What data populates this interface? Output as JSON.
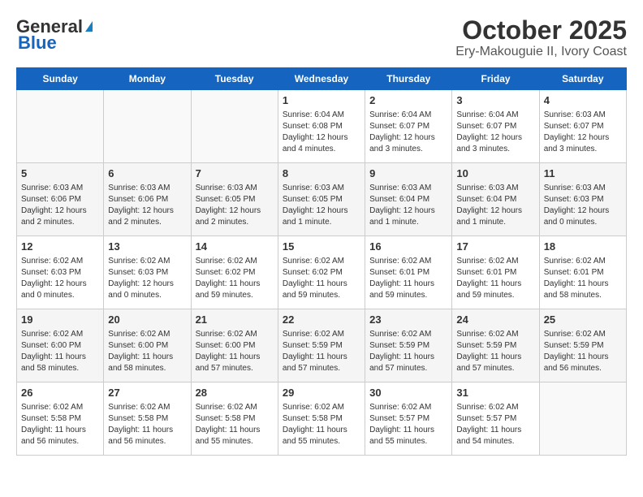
{
  "header": {
    "logo_line1": "General",
    "logo_line2": "Blue",
    "title": "October 2025",
    "subtitle": "Ery-Makouguie II, Ivory Coast"
  },
  "days_of_week": [
    "Sunday",
    "Monday",
    "Tuesday",
    "Wednesday",
    "Thursday",
    "Friday",
    "Saturday"
  ],
  "weeks": [
    [
      {
        "day": "",
        "content": ""
      },
      {
        "day": "",
        "content": ""
      },
      {
        "day": "",
        "content": ""
      },
      {
        "day": "1",
        "content": "Sunrise: 6:04 AM\nSunset: 6:08 PM\nDaylight: 12 hours\nand 4 minutes."
      },
      {
        "day": "2",
        "content": "Sunrise: 6:04 AM\nSunset: 6:07 PM\nDaylight: 12 hours\nand 3 minutes."
      },
      {
        "day": "3",
        "content": "Sunrise: 6:04 AM\nSunset: 6:07 PM\nDaylight: 12 hours\nand 3 minutes."
      },
      {
        "day": "4",
        "content": "Sunrise: 6:03 AM\nSunset: 6:07 PM\nDaylight: 12 hours\nand 3 minutes."
      }
    ],
    [
      {
        "day": "5",
        "content": "Sunrise: 6:03 AM\nSunset: 6:06 PM\nDaylight: 12 hours\nand 2 minutes."
      },
      {
        "day": "6",
        "content": "Sunrise: 6:03 AM\nSunset: 6:06 PM\nDaylight: 12 hours\nand 2 minutes."
      },
      {
        "day": "7",
        "content": "Sunrise: 6:03 AM\nSunset: 6:05 PM\nDaylight: 12 hours\nand 2 minutes."
      },
      {
        "day": "8",
        "content": "Sunrise: 6:03 AM\nSunset: 6:05 PM\nDaylight: 12 hours\nand 1 minute."
      },
      {
        "day": "9",
        "content": "Sunrise: 6:03 AM\nSunset: 6:04 PM\nDaylight: 12 hours\nand 1 minute."
      },
      {
        "day": "10",
        "content": "Sunrise: 6:03 AM\nSunset: 6:04 PM\nDaylight: 12 hours\nand 1 minute."
      },
      {
        "day": "11",
        "content": "Sunrise: 6:03 AM\nSunset: 6:03 PM\nDaylight: 12 hours\nand 0 minutes."
      }
    ],
    [
      {
        "day": "12",
        "content": "Sunrise: 6:02 AM\nSunset: 6:03 PM\nDaylight: 12 hours\nand 0 minutes."
      },
      {
        "day": "13",
        "content": "Sunrise: 6:02 AM\nSunset: 6:03 PM\nDaylight: 12 hours\nand 0 minutes."
      },
      {
        "day": "14",
        "content": "Sunrise: 6:02 AM\nSunset: 6:02 PM\nDaylight: 11 hours\nand 59 minutes."
      },
      {
        "day": "15",
        "content": "Sunrise: 6:02 AM\nSunset: 6:02 PM\nDaylight: 11 hours\nand 59 minutes."
      },
      {
        "day": "16",
        "content": "Sunrise: 6:02 AM\nSunset: 6:01 PM\nDaylight: 11 hours\nand 59 minutes."
      },
      {
        "day": "17",
        "content": "Sunrise: 6:02 AM\nSunset: 6:01 PM\nDaylight: 11 hours\nand 59 minutes."
      },
      {
        "day": "18",
        "content": "Sunrise: 6:02 AM\nSunset: 6:01 PM\nDaylight: 11 hours\nand 58 minutes."
      }
    ],
    [
      {
        "day": "19",
        "content": "Sunrise: 6:02 AM\nSunset: 6:00 PM\nDaylight: 11 hours\nand 58 minutes."
      },
      {
        "day": "20",
        "content": "Sunrise: 6:02 AM\nSunset: 6:00 PM\nDaylight: 11 hours\nand 58 minutes."
      },
      {
        "day": "21",
        "content": "Sunrise: 6:02 AM\nSunset: 6:00 PM\nDaylight: 11 hours\nand 57 minutes."
      },
      {
        "day": "22",
        "content": "Sunrise: 6:02 AM\nSunset: 5:59 PM\nDaylight: 11 hours\nand 57 minutes."
      },
      {
        "day": "23",
        "content": "Sunrise: 6:02 AM\nSunset: 5:59 PM\nDaylight: 11 hours\nand 57 minutes."
      },
      {
        "day": "24",
        "content": "Sunrise: 6:02 AM\nSunset: 5:59 PM\nDaylight: 11 hours\nand 57 minutes."
      },
      {
        "day": "25",
        "content": "Sunrise: 6:02 AM\nSunset: 5:59 PM\nDaylight: 11 hours\nand 56 minutes."
      }
    ],
    [
      {
        "day": "26",
        "content": "Sunrise: 6:02 AM\nSunset: 5:58 PM\nDaylight: 11 hours\nand 56 minutes."
      },
      {
        "day": "27",
        "content": "Sunrise: 6:02 AM\nSunset: 5:58 PM\nDaylight: 11 hours\nand 56 minutes."
      },
      {
        "day": "28",
        "content": "Sunrise: 6:02 AM\nSunset: 5:58 PM\nDaylight: 11 hours\nand 55 minutes."
      },
      {
        "day": "29",
        "content": "Sunrise: 6:02 AM\nSunset: 5:58 PM\nDaylight: 11 hours\nand 55 minutes."
      },
      {
        "day": "30",
        "content": "Sunrise: 6:02 AM\nSunset: 5:57 PM\nDaylight: 11 hours\nand 55 minutes."
      },
      {
        "day": "31",
        "content": "Sunrise: 6:02 AM\nSunset: 5:57 PM\nDaylight: 11 hours\nand 54 minutes."
      },
      {
        "day": "",
        "content": ""
      }
    ]
  ]
}
